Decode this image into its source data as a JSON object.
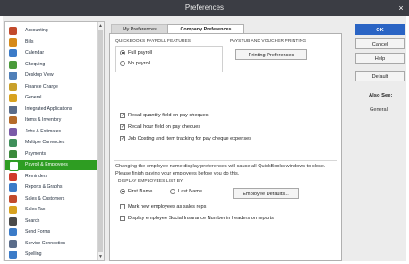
{
  "window": {
    "title": "Preferences",
    "close_glyph": "×"
  },
  "sidebar": {
    "items": [
      {
        "label": "Accounting",
        "icon": "accounting-icon",
        "color": "#c24a2c"
      },
      {
        "label": "Bills",
        "icon": "bills-icon",
        "color": "#d68a1a"
      },
      {
        "label": "Calendar",
        "icon": "calendar-icon",
        "color": "#3b7bc8"
      },
      {
        "label": "Chequing",
        "icon": "chequing-icon",
        "color": "#4a9a3a"
      },
      {
        "label": "Desktop View",
        "icon": "desktop-view-icon",
        "color": "#4f7fb8"
      },
      {
        "label": "Finance Charge",
        "icon": "finance-charge-icon",
        "color": "#c9a02a"
      },
      {
        "label": "General",
        "icon": "general-icon",
        "color": "#d8a21f"
      },
      {
        "label": "Integrated Applications",
        "icon": "integrated-apps-icon",
        "color": "#5a6c8a"
      },
      {
        "label": "Items & Inventory",
        "icon": "items-inventory-icon",
        "color": "#b56b2a"
      },
      {
        "label": "Jobs & Estimates",
        "icon": "jobs-estimates-icon",
        "color": "#7a5aa8"
      },
      {
        "label": "Multiple Currencies",
        "icon": "multiple-currencies-icon",
        "color": "#3f8f5a"
      },
      {
        "label": "Payments",
        "icon": "payments-icon",
        "color": "#3b8a3b"
      },
      {
        "label": "Payroll & Employees",
        "icon": "payroll-employees-icon",
        "color": "#ffffff",
        "selected": true
      },
      {
        "label": "Reminders",
        "icon": "reminders-icon",
        "color": "#d03a2a"
      },
      {
        "label": "Reports & Graphs",
        "icon": "reports-graphs-icon",
        "color": "#3b7bc8"
      },
      {
        "label": "Sales & Customers",
        "icon": "sales-customers-icon",
        "color": "#c24a2c"
      },
      {
        "label": "Sales Tax",
        "icon": "sales-tax-icon",
        "color": "#d8a21f"
      },
      {
        "label": "Search",
        "icon": "search-icon",
        "color": "#4a4a4a"
      },
      {
        "label": "Send Forms",
        "icon": "send-forms-icon",
        "color": "#3b7bc8"
      },
      {
        "label": "Service Connection",
        "icon": "service-connection-icon",
        "color": "#5a6c8a"
      },
      {
        "label": "Spelling",
        "icon": "spelling-icon",
        "color": "#3b7bc8"
      }
    ]
  },
  "tabs": {
    "my_preferences": "My Preferences",
    "company_preferences": "Company Preferences"
  },
  "payroll_features": {
    "heading": "QUICKBOOKS PAYROLL FEATURES",
    "options": [
      {
        "label": "Full payroll",
        "selected": true
      },
      {
        "label": "No payroll",
        "selected": false
      }
    ]
  },
  "payslip": {
    "heading": "PAYSTUB AND VOUCHER PRINTING",
    "button": "Printing Preferences"
  },
  "checkboxes": [
    {
      "label": "Recall quantity field on pay cheques",
      "checked": true
    },
    {
      "label": "Recall hour field on pay cheques",
      "checked": true
    },
    {
      "label": "Job Costing and Item tracking for pay cheque expenses",
      "checked": true
    }
  ],
  "employee_display": {
    "note": "Changing the employee name display preferences will cause all QuickBooks windows to close. Please finish paying your employees before you do this.",
    "heading": "DISPLAY EMPLOYEES LIST BY:",
    "options": [
      {
        "label": "First Name",
        "selected": true
      },
      {
        "label": "Last Name",
        "selected": false
      }
    ],
    "defaults_button": "Employee Defaults...",
    "extra_checks": [
      {
        "label": "Mark new employees as sales reps",
        "checked": false
      },
      {
        "label": "Display employee Social Insurance Number in headers on reports",
        "checked": false
      }
    ]
  },
  "actions": {
    "ok": "OK",
    "cancel": "Cancel",
    "help": "Help",
    "default": "Default"
  },
  "also_see": {
    "heading": "Also See:",
    "links": [
      "General"
    ]
  },
  "colors": {
    "accent": "#2a64c4",
    "selected": "#2e9d22",
    "titlebar": "#3b3d44"
  }
}
